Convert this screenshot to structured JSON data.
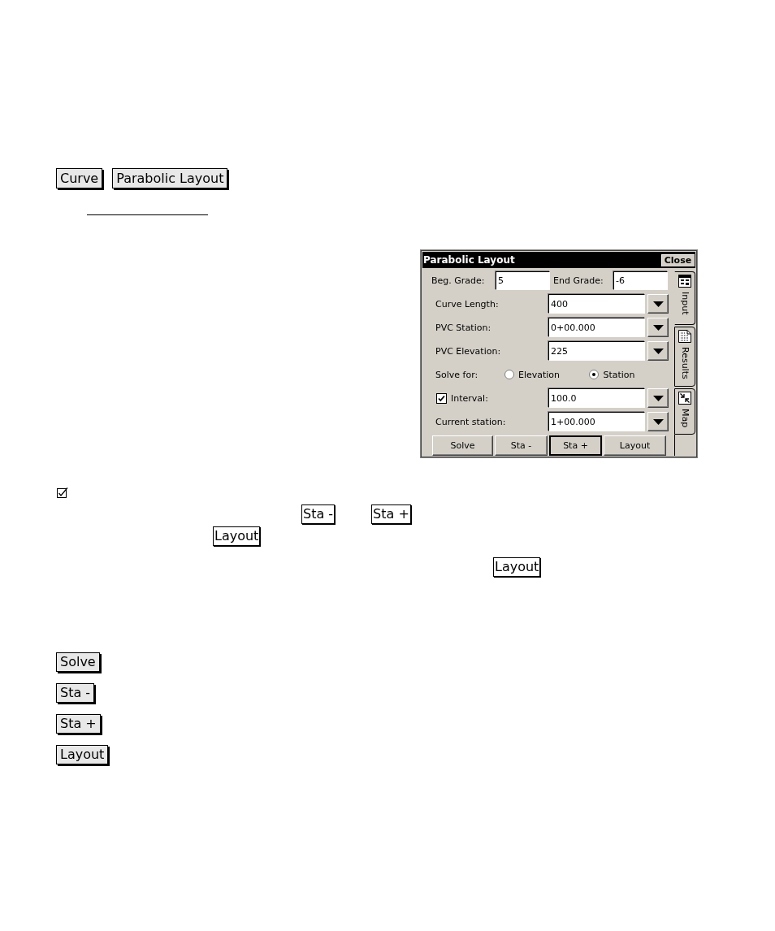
{
  "header_buttons": [
    {
      "label": "Curve"
    },
    {
      "label": "Parabolic Layout"
    }
  ],
  "dialog": {
    "title": "Parabolic Layout",
    "close": "Close",
    "grades": [
      {
        "label": "Beg. Grade:",
        "value": "5"
      },
      {
        "label": "End Grade:",
        "value": "-6"
      }
    ],
    "rows": [
      {
        "kind": "dropdown",
        "label": "Curve Length:",
        "value": "400"
      },
      {
        "kind": "dropdown",
        "label": "PVC Station:",
        "value": "0+00.000"
      },
      {
        "kind": "dropdown",
        "label": "PVC Elevation:",
        "value": "225"
      },
      {
        "kind": "choice",
        "label": "Solve for:",
        "options": [
          {
            "label": "Elevation",
            "selected": false
          },
          {
            "label": "Station",
            "selected": true
          }
        ]
      },
      {
        "kind": "check",
        "label": "Interval:",
        "checked": true,
        "value": "100.0"
      },
      {
        "kind": "dropdown",
        "label": "Current station:",
        "value": "1+00.000"
      }
    ],
    "buttons": [
      {
        "label": "Solve",
        "focused": false
      },
      {
        "label": "Sta -",
        "focused": false
      },
      {
        "label": "Sta +",
        "focused": true
      },
      {
        "label": "Layout",
        "focused": false
      }
    ],
    "tabs": [
      {
        "kind": "form",
        "label": "Input",
        "selected": true
      },
      {
        "kind": "report",
        "label": "Results",
        "selected": false
      },
      {
        "kind": "map",
        "label": "Map",
        "selected": false
      }
    ]
  },
  "inline_buttons": [
    {
      "label": "Sta -"
    },
    {
      "label": "Sta +"
    },
    {
      "label": "Layout"
    },
    {
      "label": "Layout"
    }
  ],
  "key_buttons": [
    {
      "label": "Solve"
    },
    {
      "label": "Sta -"
    },
    {
      "label": "Sta +"
    },
    {
      "label": "Layout"
    }
  ]
}
